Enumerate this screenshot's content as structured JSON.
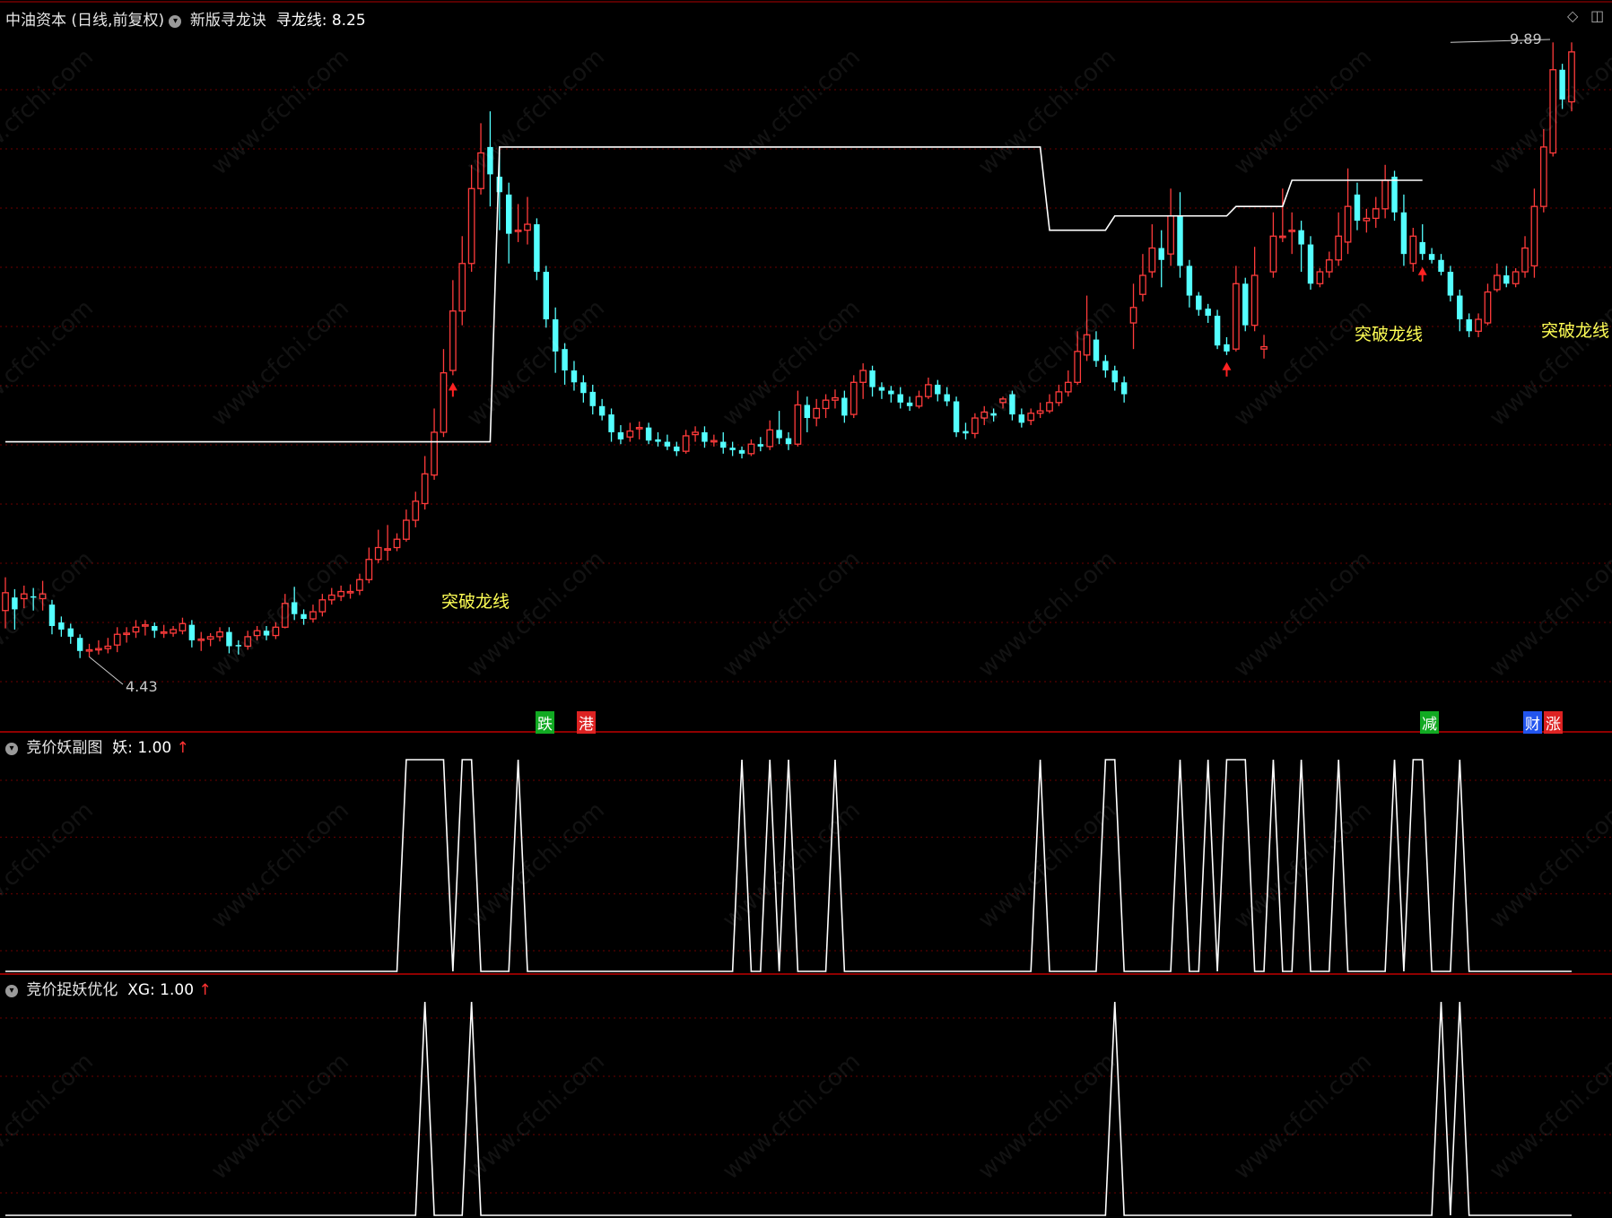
{
  "header": {
    "stock": "中油资本",
    "mode": "(日线,前复权)",
    "indicator": "新版寻龙诀",
    "line_name": "寻龙线",
    "line_value": ": 8.25"
  },
  "panel2": {
    "name": "竞价妖副图",
    "series": "妖",
    "value": ": 1.00"
  },
  "panel3": {
    "name": "竞价捉妖优化",
    "series": "XG",
    "value": ": 1.00"
  },
  "watermark": "www.cfchi.com",
  "colors": {
    "up": "#ff3b3b",
    "down": "#54ffff",
    "line": "#ffffff",
    "grid": "#6b0000",
    "signal": "#ffff55"
  },
  "chart_data": [
    {
      "type": "candlestick",
      "price_labels": {
        "high": "9.89",
        "low": "4.43"
      },
      "signals": [
        "突破龙线",
        "突破龙线",
        "突破龙线"
      ],
      "tags": [
        {
          "text": "跌",
          "color": "#11aa22"
        },
        {
          "text": "港",
          "color": "#dd2222"
        },
        {
          "text": "减",
          "color": "#11aa22"
        },
        {
          "text": "财",
          "color": "#2255ee"
        },
        {
          "text": "涨",
          "color": "#dd2222"
        }
      ],
      "candles": [
        [
          5.2,
          5.35,
          5.48,
          5.05
        ],
        [
          5.31,
          5.21,
          5.38,
          5.04
        ],
        [
          5.3,
          5.34,
          5.41,
          5.22
        ],
        [
          5.32,
          5.31,
          5.39,
          5.2
        ],
        [
          5.3,
          5.34,
          5.45,
          5.2
        ],
        [
          5.25,
          5.07,
          5.29,
          5.0
        ],
        [
          5.1,
          5.04,
          5.15,
          4.98
        ],
        [
          5.05,
          4.98,
          5.09,
          4.92
        ],
        [
          4.97,
          4.86,
          5.0,
          4.8
        ],
        [
          4.86,
          4.87,
          4.92,
          4.81
        ],
        [
          4.88,
          4.88,
          4.95,
          4.83
        ],
        [
          4.88,
          4.9,
          4.97,
          4.84
        ],
        [
          4.91,
          5.0,
          5.06,
          4.85
        ],
        [
          5.0,
          5.01,
          5.06,
          4.93
        ],
        [
          5.02,
          5.06,
          5.12,
          4.97
        ],
        [
          5.07,
          5.08,
          5.12,
          4.99
        ],
        [
          5.07,
          5.03,
          5.1,
          4.97
        ],
        [
          5.02,
          5.02,
          5.08,
          4.97
        ],
        [
          5.01,
          5.04,
          5.07,
          4.98
        ],
        [
          5.03,
          5.09,
          5.14,
          5.0
        ],
        [
          5.08,
          4.95,
          5.12,
          4.89
        ],
        [
          4.96,
          4.96,
          5.02,
          4.86
        ],
        [
          4.96,
          4.98,
          5.01,
          4.9
        ],
        [
          4.98,
          5.02,
          5.06,
          4.94
        ],
        [
          5.02,
          4.9,
          5.06,
          4.84
        ],
        [
          4.91,
          4.9,
          4.95,
          4.83
        ],
        [
          4.9,
          4.98,
          5.03,
          4.87
        ],
        [
          4.99,
          5.03,
          5.07,
          4.95
        ],
        [
          5.03,
          4.99,
          5.07,
          4.95
        ],
        [
          4.99,
          5.06,
          5.1,
          4.96
        ],
        [
          5.06,
          5.26,
          5.34,
          5.05
        ],
        [
          5.27,
          5.17,
          5.4,
          5.12
        ],
        [
          5.17,
          5.13,
          5.21,
          5.08
        ],
        [
          5.13,
          5.19,
          5.25,
          5.1
        ],
        [
          5.19,
          5.29,
          5.34,
          5.15
        ],
        [
          5.29,
          5.33,
          5.39,
          5.25
        ],
        [
          5.32,
          5.36,
          5.41,
          5.28
        ],
        [
          5.36,
          5.36,
          5.42,
          5.3
        ],
        [
          5.37,
          5.46,
          5.51,
          5.33
        ],
        [
          5.46,
          5.63,
          5.73,
          5.43
        ],
        [
          5.63,
          5.73,
          5.88,
          5.6
        ],
        [
          5.72,
          5.72,
          5.92,
          5.62
        ],
        [
          5.73,
          5.8,
          5.85,
          5.7
        ],
        [
          5.8,
          5.96,
          6.05,
          5.78
        ],
        [
          5.96,
          6.12,
          6.2,
          5.9
        ],
        [
          6.1,
          6.35,
          6.5,
          6.05
        ],
        [
          6.34,
          6.7,
          6.9,
          6.3
        ],
        [
          6.7,
          7.2,
          7.4,
          6.66
        ],
        [
          7.22,
          7.72,
          7.98,
          7.18
        ],
        [
          7.72,
          8.12,
          8.35,
          7.6
        ],
        [
          8.12,
          8.75,
          8.95,
          8.05
        ],
        [
          8.75,
          9.05,
          9.3,
          8.7
        ],
        [
          9.1,
          8.87,
          9.4,
          8.6
        ],
        [
          8.85,
          8.72,
          9.05,
          8.4
        ],
        [
          8.7,
          8.37,
          8.8,
          8.12
        ],
        [
          8.4,
          8.4,
          8.62,
          8.3
        ],
        [
          8.4,
          8.45,
          8.68,
          8.28
        ],
        [
          8.45,
          8.05,
          8.5,
          7.98
        ],
        [
          8.05,
          7.65,
          8.1,
          7.58
        ],
        [
          7.65,
          7.38,
          7.75,
          7.2
        ],
        [
          7.4,
          7.22,
          7.45,
          7.1
        ],
        [
          7.22,
          7.12,
          7.3,
          7.05
        ],
        [
          7.12,
          7.03,
          7.18,
          6.95
        ],
        [
          7.04,
          6.92,
          7.1,
          6.85
        ],
        [
          6.92,
          6.84,
          6.98,
          6.8
        ],
        [
          6.85,
          6.7,
          6.9,
          6.62
        ],
        [
          6.7,
          6.64,
          6.76,
          6.6
        ],
        [
          6.66,
          6.71,
          6.78,
          6.62
        ],
        [
          6.73,
          6.74,
          6.79,
          6.64
        ],
        [
          6.74,
          6.63,
          6.78,
          6.6
        ],
        [
          6.64,
          6.62,
          6.7,
          6.58
        ],
        [
          6.62,
          6.58,
          6.68,
          6.55
        ],
        [
          6.58,
          6.54,
          6.62,
          6.5
        ],
        [
          6.54,
          6.67,
          6.72,
          6.52
        ],
        [
          6.68,
          6.7,
          6.75,
          6.62
        ],
        [
          6.7,
          6.62,
          6.75,
          6.57
        ],
        [
          6.62,
          6.63,
          6.68,
          6.58
        ],
        [
          6.62,
          6.57,
          6.7,
          6.52
        ],
        [
          6.57,
          6.55,
          6.62,
          6.5
        ],
        [
          6.55,
          6.52,
          6.58,
          6.48
        ],
        [
          6.52,
          6.6,
          6.64,
          6.5
        ],
        [
          6.6,
          6.58,
          6.66,
          6.54
        ],
        [
          6.58,
          6.72,
          6.8,
          6.55
        ],
        [
          6.72,
          6.65,
          6.88,
          6.6
        ],
        [
          6.65,
          6.6,
          6.7,
          6.55
        ],
        [
          6.6,
          6.93,
          7.05,
          6.58
        ],
        [
          6.93,
          6.82,
          7.0,
          6.7
        ],
        [
          6.82,
          6.9,
          6.98,
          6.75
        ],
        [
          6.9,
          6.97,
          7.02,
          6.82
        ],
        [
          6.97,
          6.99,
          7.06,
          6.9
        ],
        [
          6.99,
          6.84,
          7.05,
          6.78
        ],
        [
          6.85,
          7.12,
          7.18,
          6.82
        ],
        [
          7.12,
          7.22,
          7.28,
          6.98
        ],
        [
          7.22,
          7.08,
          7.26,
          7.0
        ],
        [
          7.08,
          7.05,
          7.12,
          6.98
        ],
        [
          7.05,
          7.02,
          7.09,
          6.95
        ],
        [
          7.02,
          6.95,
          7.08,
          6.9
        ],
        [
          6.95,
          6.92,
          7.0,
          6.88
        ],
        [
          6.92,
          7.0,
          7.05,
          6.9
        ],
        [
          7.0,
          7.1,
          7.16,
          6.98
        ],
        [
          7.1,
          7.02,
          7.14,
          6.96
        ],
        [
          7.02,
          6.96,
          7.08,
          6.92
        ],
        [
          6.96,
          6.7,
          7.0,
          6.66
        ],
        [
          6.71,
          6.69,
          6.78,
          6.64
        ],
        [
          6.69,
          6.82,
          6.86,
          6.65
        ],
        [
          6.82,
          6.87,
          6.92,
          6.76
        ],
        [
          6.86,
          6.84,
          6.9,
          6.79
        ],
        [
          6.95,
          6.98,
          7.0,
          6.9
        ],
        [
          7.02,
          6.85,
          7.05,
          6.8
        ],
        [
          6.85,
          6.78,
          6.9,
          6.74
        ],
        [
          6.8,
          6.86,
          6.9,
          6.76
        ],
        [
          6.86,
          6.88,
          6.95,
          6.82
        ],
        [
          6.88,
          6.95,
          7.02,
          6.86
        ],
        [
          6.95,
          7.04,
          7.1,
          6.92
        ],
        [
          7.04,
          7.12,
          7.22,
          7.0
        ],
        [
          7.12,
          7.38,
          7.55,
          7.1
        ],
        [
          7.35,
          7.52,
          7.85,
          7.3
        ],
        [
          7.48,
          7.3,
          7.55,
          7.25
        ],
        [
          7.3,
          7.22,
          7.35,
          7.16
        ],
        [
          7.22,
          7.12,
          7.26,
          7.05
        ],
        [
          7.12,
          7.02,
          7.17,
          6.95
        ],
        [
          7.62,
          7.75,
          7.95,
          7.4
        ],
        [
          7.86,
          8.02,
          8.2,
          7.8
        ],
        [
          8.05,
          8.25,
          8.45,
          8.0
        ],
        [
          8.25,
          8.15,
          8.4,
          7.92
        ],
        [
          8.2,
          8.52,
          8.75,
          8.1
        ],
        [
          8.52,
          8.1,
          8.72,
          8.0
        ],
        [
          8.1,
          7.85,
          8.15,
          7.75
        ],
        [
          7.85,
          7.73,
          7.88,
          7.68
        ],
        [
          7.74,
          7.68,
          7.78,
          7.62
        ],
        [
          7.68,
          7.43,
          7.73,
          7.4
        ],
        [
          7.44,
          7.38,
          7.5,
          7.35
        ],
        [
          7.4,
          7.95,
          8.1,
          7.38
        ],
        [
          7.95,
          7.6,
          8.0,
          7.55
        ],
        [
          7.6,
          8.02,
          8.26,
          7.55
        ],
        [
          7.4,
          7.42,
          7.52,
          7.32
        ],
        [
          8.05,
          8.35,
          8.55,
          8.0
        ],
        [
          8.35,
          8.35,
          8.75,
          8.3
        ],
        [
          8.4,
          8.4,
          8.55,
          8.2
        ],
        [
          8.4,
          8.28,
          8.48,
          8.05
        ],
        [
          8.28,
          7.95,
          8.35,
          7.9
        ],
        [
          7.95,
          8.05,
          8.08,
          7.92
        ],
        [
          8.05,
          8.15,
          8.22,
          8.0
        ],
        [
          8.15,
          8.35,
          8.55,
          8.1
        ],
        [
          8.3,
          8.6,
          8.92,
          8.2
        ],
        [
          8.7,
          8.48,
          8.8,
          8.4
        ],
        [
          8.48,
          8.5,
          8.58,
          8.38
        ],
        [
          8.5,
          8.58,
          8.68,
          8.42
        ],
        [
          8.58,
          8.82,
          8.95,
          8.5
        ],
        [
          8.85,
          8.55,
          8.9,
          8.48
        ],
        [
          8.55,
          8.2,
          8.7,
          8.1
        ],
        [
          8.12,
          8.35,
          8.42,
          8.05
        ],
        [
          8.3,
          8.2,
          8.45,
          8.15
        ],
        [
          8.2,
          8.15,
          8.25,
          8.12
        ],
        [
          8.15,
          8.05,
          8.2,
          8.02
        ],
        [
          8.05,
          7.85,
          8.1,
          7.8
        ],
        [
          7.85,
          7.65,
          7.9,
          7.55
        ],
        [
          7.65,
          7.55,
          7.7,
          7.5
        ],
        [
          7.55,
          7.65,
          7.7,
          7.5
        ],
        [
          7.62,
          7.88,
          7.95,
          7.6
        ],
        [
          7.9,
          8.02,
          8.12,
          7.88
        ],
        [
          8.02,
          7.95,
          8.1,
          7.92
        ],
        [
          7.95,
          8.05,
          8.08,
          7.92
        ],
        [
          8.05,
          8.25,
          8.35,
          8.0
        ],
        [
          8.1,
          8.6,
          8.75,
          8.0
        ],
        [
          8.6,
          9.1,
          9.25,
          8.55
        ],
        [
          9.05,
          9.75,
          9.98,
          9.02
        ],
        [
          9.75,
          9.5,
          9.8,
          9.42
        ],
        [
          9.48,
          9.9,
          9.98,
          9.4
        ]
      ],
      "dragon_line": [
        [
          0,
          6.62
        ],
        [
          52,
          6.62
        ],
        [
          53,
          9.1
        ],
        [
          111,
          9.1
        ],
        [
          112,
          8.4
        ],
        [
          118,
          8.4
        ],
        [
          119,
          8.52
        ],
        [
          131,
          8.52
        ],
        [
          132,
          8.6
        ],
        [
          137,
          8.6
        ],
        [
          138,
          8.82
        ],
        [
          152,
          8.82
        ]
      ],
      "ylim": [
        4.3,
        10.05
      ]
    },
    {
      "type": "line",
      "series_name": "妖",
      "ylim": [
        0,
        1
      ],
      "high_ranges": [
        [
          43,
          47
        ],
        [
          49,
          50
        ],
        [
          55,
          55
        ],
        [
          79,
          79
        ],
        [
          82,
          82
        ],
        [
          84,
          84
        ],
        [
          89,
          89
        ],
        [
          111,
          111
        ],
        [
          118,
          119
        ],
        [
          126,
          126
        ],
        [
          129,
          129
        ],
        [
          131,
          133
        ],
        [
          136,
          136
        ],
        [
          139,
          139
        ],
        [
          143,
          143
        ],
        [
          149,
          149
        ],
        [
          151,
          152
        ],
        [
          156,
          156
        ]
      ]
    },
    {
      "type": "line",
      "series_name": "XG",
      "ylim": [
        0,
        1
      ],
      "high_ranges": [
        [
          45,
          45
        ],
        [
          50,
          50
        ],
        [
          119,
          119
        ],
        [
          154,
          154
        ],
        [
          156,
          156
        ]
      ]
    }
  ]
}
